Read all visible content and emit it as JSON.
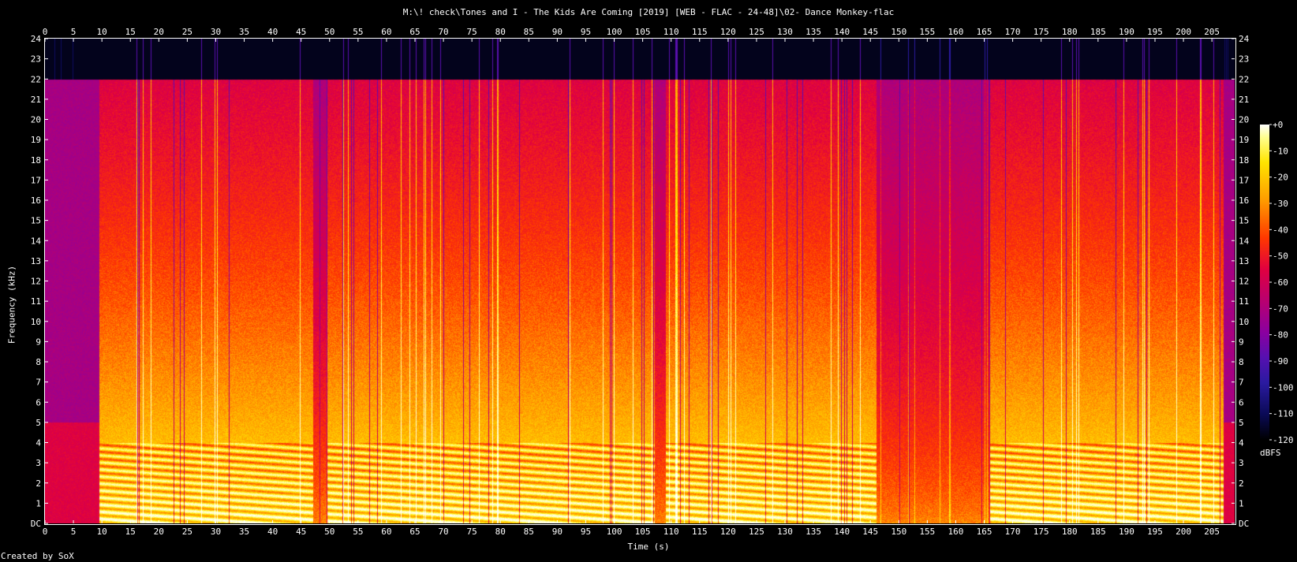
{
  "title": "M:\\! check\\Tones and I - The Kids Are Coming [2019] [WEB - FLAC - 24-48]\\02- Dance Monkey-flac",
  "footer": "Created by SoX",
  "colors": {
    "background": "#000000",
    "foreground": "#ffffff",
    "palette": [
      "#000000",
      "#0a0a55",
      "#2a1aa0",
      "#5510b0",
      "#8a00a0",
      "#b80070",
      "#e00040",
      "#ff3800",
      "#ff9c00",
      "#ffe400",
      "#ffff90",
      "#ffffff"
    ]
  },
  "chart_data": {
    "type": "heatmap",
    "title": "M:\\! check\\Tones and I - The Kids Are Coming [2019] [WEB - FLAC - 24-48]\\02- Dance Monkey-flac",
    "xlabel": "Time (s)",
    "ylabel": "Frequency (kHz)",
    "xlim": [
      0,
      209
    ],
    "ylim": [
      0,
      24
    ],
    "x_ticks": [
      "0",
      "5",
      "10",
      "15",
      "20",
      "25",
      "30",
      "35",
      "40",
      "45",
      "50",
      "55",
      "60",
      "65",
      "70",
      "75",
      "80",
      "85",
      "90",
      "95",
      "100",
      "105",
      "110",
      "115",
      "120",
      "125",
      "130",
      "135",
      "140",
      "145",
      "150",
      "155",
      "160",
      "165",
      "170",
      "175",
      "180",
      "185",
      "190",
      "195",
      "200",
      "205"
    ],
    "y_ticks": [
      "DC",
      "1",
      "2",
      "3",
      "4",
      "5",
      "6",
      "7",
      "8",
      "9",
      "10",
      "11",
      "12",
      "13",
      "14",
      "15",
      "16",
      "17",
      "18",
      "19",
      "20",
      "21",
      "22",
      "23",
      "24"
    ],
    "colorbar": {
      "label": "dBFS",
      "ticks": [
        "+0",
        "-10",
        "-20",
        "-30",
        "-40",
        "-50",
        "-60",
        "-70",
        "-80",
        "-90",
        "-100",
        "-110",
        "-120"
      ],
      "range": [
        -120,
        0
      ]
    },
    "content_cutoff_khz": 22,
    "grid": false,
    "segments": [
      {
        "start": 0,
        "end": 9.5,
        "level": "quiet"
      },
      {
        "start": 9.5,
        "end": 47,
        "level": "loud"
      },
      {
        "start": 47,
        "end": 49.5,
        "level": "medium"
      },
      {
        "start": 49.5,
        "end": 87,
        "level": "loud"
      },
      {
        "start": 87,
        "end": 107,
        "level": "loud"
      },
      {
        "start": 107,
        "end": 109,
        "level": "medium"
      },
      {
        "start": 109,
        "end": 127,
        "level": "loud"
      },
      {
        "start": 127,
        "end": 146,
        "level": "loud"
      },
      {
        "start": 146,
        "end": 166,
        "level": "medium"
      },
      {
        "start": 166,
        "end": 207,
        "level": "loud"
      },
      {
        "start": 207,
        "end": 209,
        "level": "quiet"
      }
    ]
  }
}
